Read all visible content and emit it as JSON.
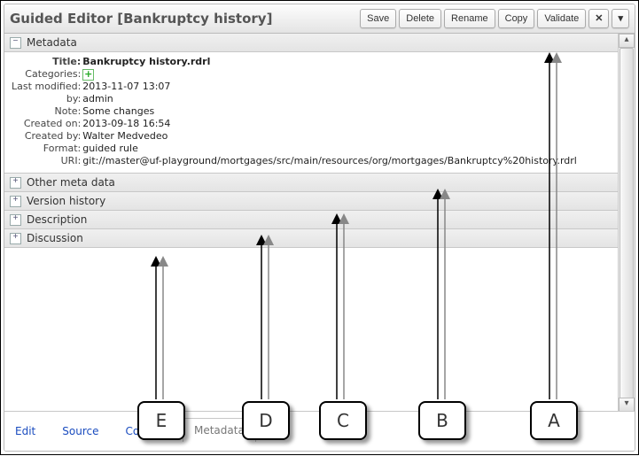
{
  "header": {
    "title": "Guided Editor [Bankruptcy history]",
    "buttons": {
      "save": "Save",
      "delete": "Delete",
      "rename": "Rename",
      "copy": "Copy",
      "validate": "Validate",
      "close": "✕",
      "menu": "▾"
    }
  },
  "sections": {
    "metadata": {
      "label": "Metadata",
      "expanded": true,
      "toggle": "−"
    },
    "other": {
      "label": "Other meta data",
      "expanded": false,
      "toggle": "+"
    },
    "version": {
      "label": "Version history",
      "expanded": false,
      "toggle": "+"
    },
    "desc": {
      "label": "Description",
      "expanded": false,
      "toggle": "+"
    },
    "disc": {
      "label": "Discussion",
      "expanded": false,
      "toggle": "+"
    }
  },
  "metadata": {
    "title_k": "Title:",
    "title_v": "Bankruptcy history.rdrl",
    "cat_k": "Categories:",
    "cat_icon": "add-category-icon",
    "mod_k": "Last modified:",
    "mod_v": "2013-11-07 13:07",
    "by_k": "by:",
    "by_v": "admin",
    "note_k": "Note:",
    "note_v": "Some changes",
    "created_k": "Created on:",
    "created_v": "2013-09-18 16:54",
    "createdby_k": "Created by:",
    "createdby_v": "Walter Medvedeo",
    "format_k": "Format:",
    "format_v": "guided rule",
    "uri_k": "URI:",
    "uri_v": "git://master@uf-playground/mortgages/src/main/resources/org/mortgages/Bankruptcy%20history.rdrl"
  },
  "tabs": {
    "edit": "Edit",
    "source": "Source",
    "config": "Config",
    "metadata": "Metadata",
    "active": "metadata"
  },
  "annotations": {
    "A": "A",
    "B": "B",
    "C": "C",
    "D": "D",
    "E": "E"
  }
}
